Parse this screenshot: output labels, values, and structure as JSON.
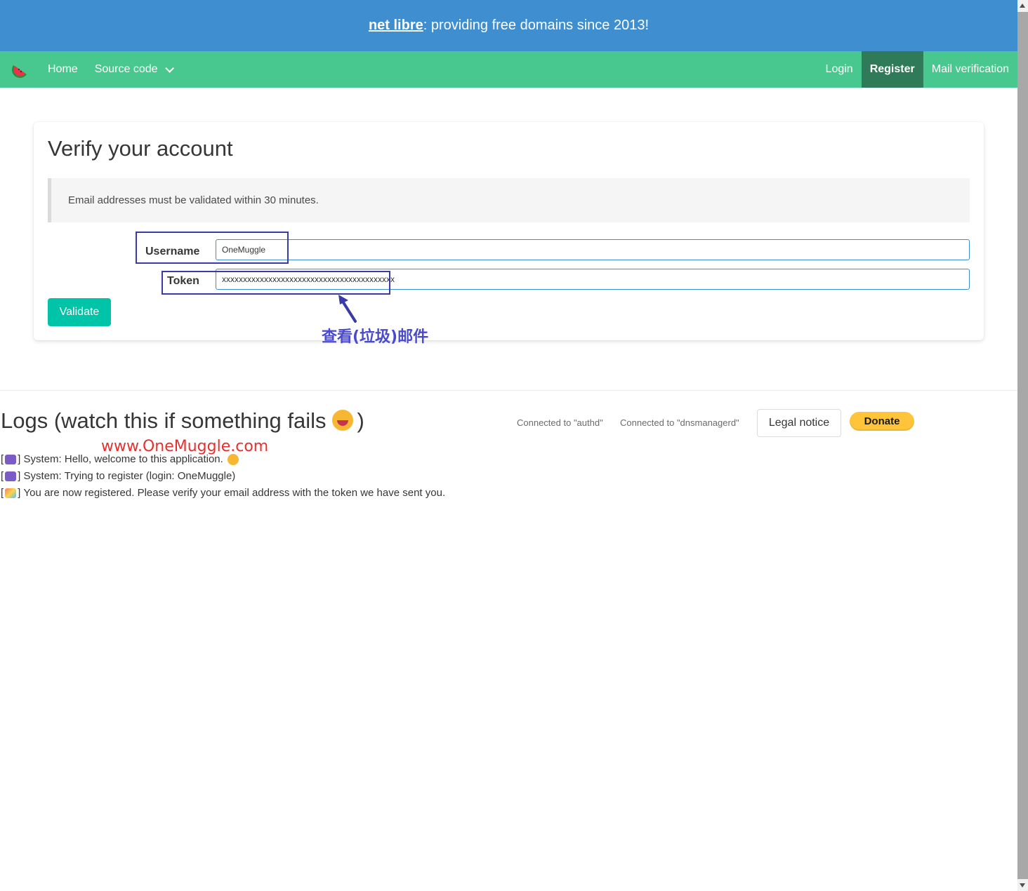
{
  "banner": {
    "link": "net libre",
    "rest": ": providing free domains since 2013!"
  },
  "nav": {
    "left": [
      {
        "label": "Home"
      },
      {
        "label": "Source code"
      }
    ],
    "right": [
      {
        "label": "Login"
      },
      {
        "label": "Register"
      },
      {
        "label": "Mail verification"
      }
    ],
    "active": "Register"
  },
  "form": {
    "title": "Verify your account",
    "notice": "Email addresses must be validated within 30 minutes.",
    "username_label": "Username",
    "username_value": "OneMuggle",
    "token_label": "Token",
    "token_value": "xxxxxxxxxxxxxxxxxxxxxxxxxxxxxxxxxxxxxxxxx",
    "validate_label": "Validate"
  },
  "annotation": {
    "text": "查看(垃圾)邮件"
  },
  "logs": {
    "title": "Logs (watch this if something fails",
    "title_end": ")",
    "watermark": "www.OneMuggle.com",
    "entries": [
      {
        "icon": "robot-icon",
        "text": "System: Hello, welcome to this application."
      },
      {
        "icon": "robot-icon",
        "text": "System: Trying to register (login: OneMuggle)"
      },
      {
        "icon": "party-popper-icon",
        "text": "You are now registered. Please verify your email address with the token we have sent you."
      }
    ]
  },
  "footer": {
    "status_authd": "Connected to \"authd\"",
    "status_dns": "Connected to \"dnsmanagerd\"",
    "legal_label": "Legal notice",
    "donate_label": "Donate"
  },
  "colors": {
    "banner": "#3e8ed0",
    "navbar": "#48c78e",
    "nav_active": "#2f7a58",
    "validate": "#00c4a7",
    "donate": "#ffc439"
  }
}
